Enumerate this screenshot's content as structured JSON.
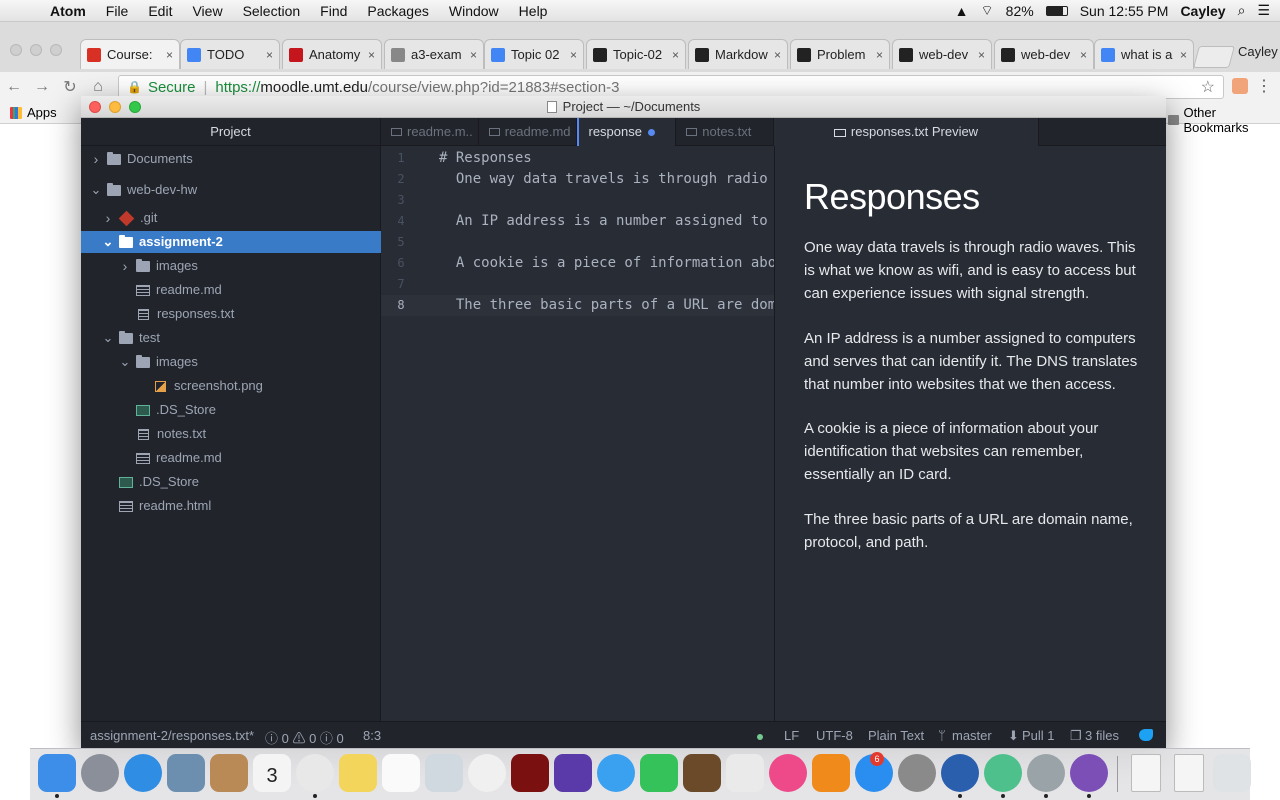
{
  "menubar": {
    "apple_glyph": "",
    "app_name": "Atom",
    "items": [
      "File",
      "Edit",
      "View",
      "Selection",
      "Find",
      "Packages",
      "Window",
      "Help"
    ],
    "battery": "82%",
    "clock": "Sun 12:55 PM",
    "user": "Cayley"
  },
  "browser": {
    "tabs": [
      {
        "label": "Course:",
        "favicon": "power-icon",
        "color": "#d93025"
      },
      {
        "label": "TODO",
        "favicon": "drive-icon",
        "color": "#4285f4"
      },
      {
        "label": "Anatomy",
        "favicon": "d-logo-icon",
        "color": "#c4161c"
      },
      {
        "label": "a3-exam",
        "favicon": "document-icon",
        "color": "#888888"
      },
      {
        "label": "Topic 02",
        "favicon": "drive-icon",
        "color": "#4285f4"
      },
      {
        "label": "Topic-02",
        "favicon": "codepen-icon",
        "color": "#222222"
      },
      {
        "label": "Markdow",
        "favicon": "github-icon",
        "color": "#222222"
      },
      {
        "label": "Problem",
        "favicon": "github-icon",
        "color": "#222222"
      },
      {
        "label": "web-dev",
        "favicon": "github-icon",
        "color": "#222222"
      },
      {
        "label": "web-dev",
        "favicon": "github-icon",
        "color": "#222222"
      },
      {
        "label": "what is a",
        "favicon": "google-icon",
        "color": "#4285f4"
      }
    ],
    "tab_close": "×",
    "profile_name": "Cayley",
    "secure_label": "Secure",
    "url_scheme": "https://",
    "url_host": "moodle.umt.edu",
    "url_path": "/course/view.php?id=21883#section-3",
    "apps_label": "Apps",
    "other_bookmarks": "Other Bookmarks"
  },
  "atom": {
    "window_title": "Project — ~/Documents",
    "tree": {
      "header": "Project",
      "items": [
        {
          "label": "Documents",
          "type": "folder",
          "expanded": false
        },
        {
          "label": "web-dev-hw",
          "type": "folder",
          "expanded": true
        },
        {
          "label": ".git",
          "type": "git",
          "expanded": false
        },
        {
          "label": "assignment-2",
          "type": "folder",
          "expanded": true,
          "selected": true
        },
        {
          "label": "images",
          "type": "folder",
          "expanded": false
        },
        {
          "label": "readme.md",
          "type": "md"
        },
        {
          "label": "responses.txt",
          "type": "txt"
        },
        {
          "label": "test",
          "type": "folder",
          "expanded": true
        },
        {
          "label": "images",
          "type": "folder",
          "expanded": true
        },
        {
          "label": "screenshot.png",
          "type": "img"
        },
        {
          "label": ".DS_Store",
          "type": "ds"
        },
        {
          "label": "notes.txt",
          "type": "txt"
        },
        {
          "label": "readme.md",
          "type": "md"
        },
        {
          "label": ".DS_Store",
          "type": "ds"
        },
        {
          "label": "readme.html",
          "type": "md"
        }
      ]
    },
    "tabs": [
      {
        "label": "readme.m..",
        "active": false
      },
      {
        "label": "readme.md",
        "active": false
      },
      {
        "label": "response",
        "active": true,
        "modified": true
      },
      {
        "label": "notes.txt",
        "active": false
      }
    ],
    "preview_tab": "responses.txt Preview",
    "editor_lines": [
      {
        "n": "1",
        "text": "# Responses"
      },
      {
        "n": "2",
        "text": "  One way data travels is through radio"
      },
      {
        "n": "3",
        "text": ""
      },
      {
        "n": "4",
        "text": "  An IP address is a number assigned to"
      },
      {
        "n": "5",
        "text": ""
      },
      {
        "n": "6",
        "text": "  A cookie is a piece of information abo"
      },
      {
        "n": "7",
        "text": ""
      },
      {
        "n": "8",
        "text": "  The three basic parts of a URL are dom",
        "current": true
      }
    ],
    "preview": {
      "heading": "Responses",
      "paragraphs": [
        "One way data travels is through radio waves. This is what we know as wifi, and is easy to access but can experience issues with signal strength.",
        "An IP address is a number assigned to computers and serves that can identify it. The DNS translates that number into websites that we then access.",
        "A cookie is a piece of information about your identification that websites can remember, essentially an ID card.",
        "The three basic parts of a URL are domain name, protocol, and path."
      ]
    },
    "status": {
      "path": "assignment-2/responses.txt*",
      "diagnostics": "ⓘ 0 ⚠ 0 ⓘ 0",
      "cursor": "8:3",
      "line_ending": "LF",
      "encoding": "UTF-8",
      "grammar": "Plain Text",
      "branch": "master",
      "pull": "Pull 1",
      "files": "3 files"
    }
  },
  "dock": {
    "apps": [
      {
        "name": "finder-icon",
        "color": "#3d8ee8"
      },
      {
        "name": "launchpad-icon",
        "color": "#8a8f99"
      },
      {
        "name": "safari-icon",
        "color": "#2f8de4"
      },
      {
        "name": "preview-icon",
        "color": "#6c8fb0"
      },
      {
        "name": "contacts-icon",
        "color": "#b98a55"
      },
      {
        "name": "calendar-icon",
        "color": "#f4f4f4"
      },
      {
        "name": "chrome-icon",
        "color": "#e8e8e8"
      },
      {
        "name": "notes-icon",
        "color": "#f3d55b"
      },
      {
        "name": "reminders-icon",
        "color": "#fafafa"
      },
      {
        "name": "preview-app-icon",
        "color": "#d0d8e0"
      },
      {
        "name": "photos-icon",
        "color": "#f0f0f0"
      },
      {
        "name": "photo-booth-icon",
        "color": "#7a1010"
      },
      {
        "name": "imovie-icon",
        "color": "#5a3aa8"
      },
      {
        "name": "messages-icon",
        "color": "#3aa0f0"
      },
      {
        "name": "facetime-icon",
        "color": "#36c25a"
      },
      {
        "name": "garageband-icon",
        "color": "#6b4a2a"
      },
      {
        "name": "textedit-icon",
        "color": "#eaeaea"
      },
      {
        "name": "itunes-icon",
        "color": "#ee4a8a"
      },
      {
        "name": "ibooks-icon",
        "color": "#f08a1a"
      },
      {
        "name": "app-store-icon",
        "color": "#2a8ef0"
      },
      {
        "name": "system-preferences-icon",
        "color": "#8a8a8a"
      },
      {
        "name": "r-icon",
        "color": "#2a5fae"
      },
      {
        "name": "atom-icon",
        "color": "#4ec08b"
      },
      {
        "name": "tex-icon",
        "color": "#9aa4a8"
      },
      {
        "name": "github-desktop-icon",
        "color": "#7b4fb6"
      },
      {
        "name": "zip-file-icon",
        "color": "#f5f5f5"
      },
      {
        "name": "png-file-icon",
        "color": "#f5f5f5"
      },
      {
        "name": "trash-icon",
        "color": "#dfe3e6"
      }
    ],
    "calendar_day": "3",
    "app_store_badge": "6"
  }
}
